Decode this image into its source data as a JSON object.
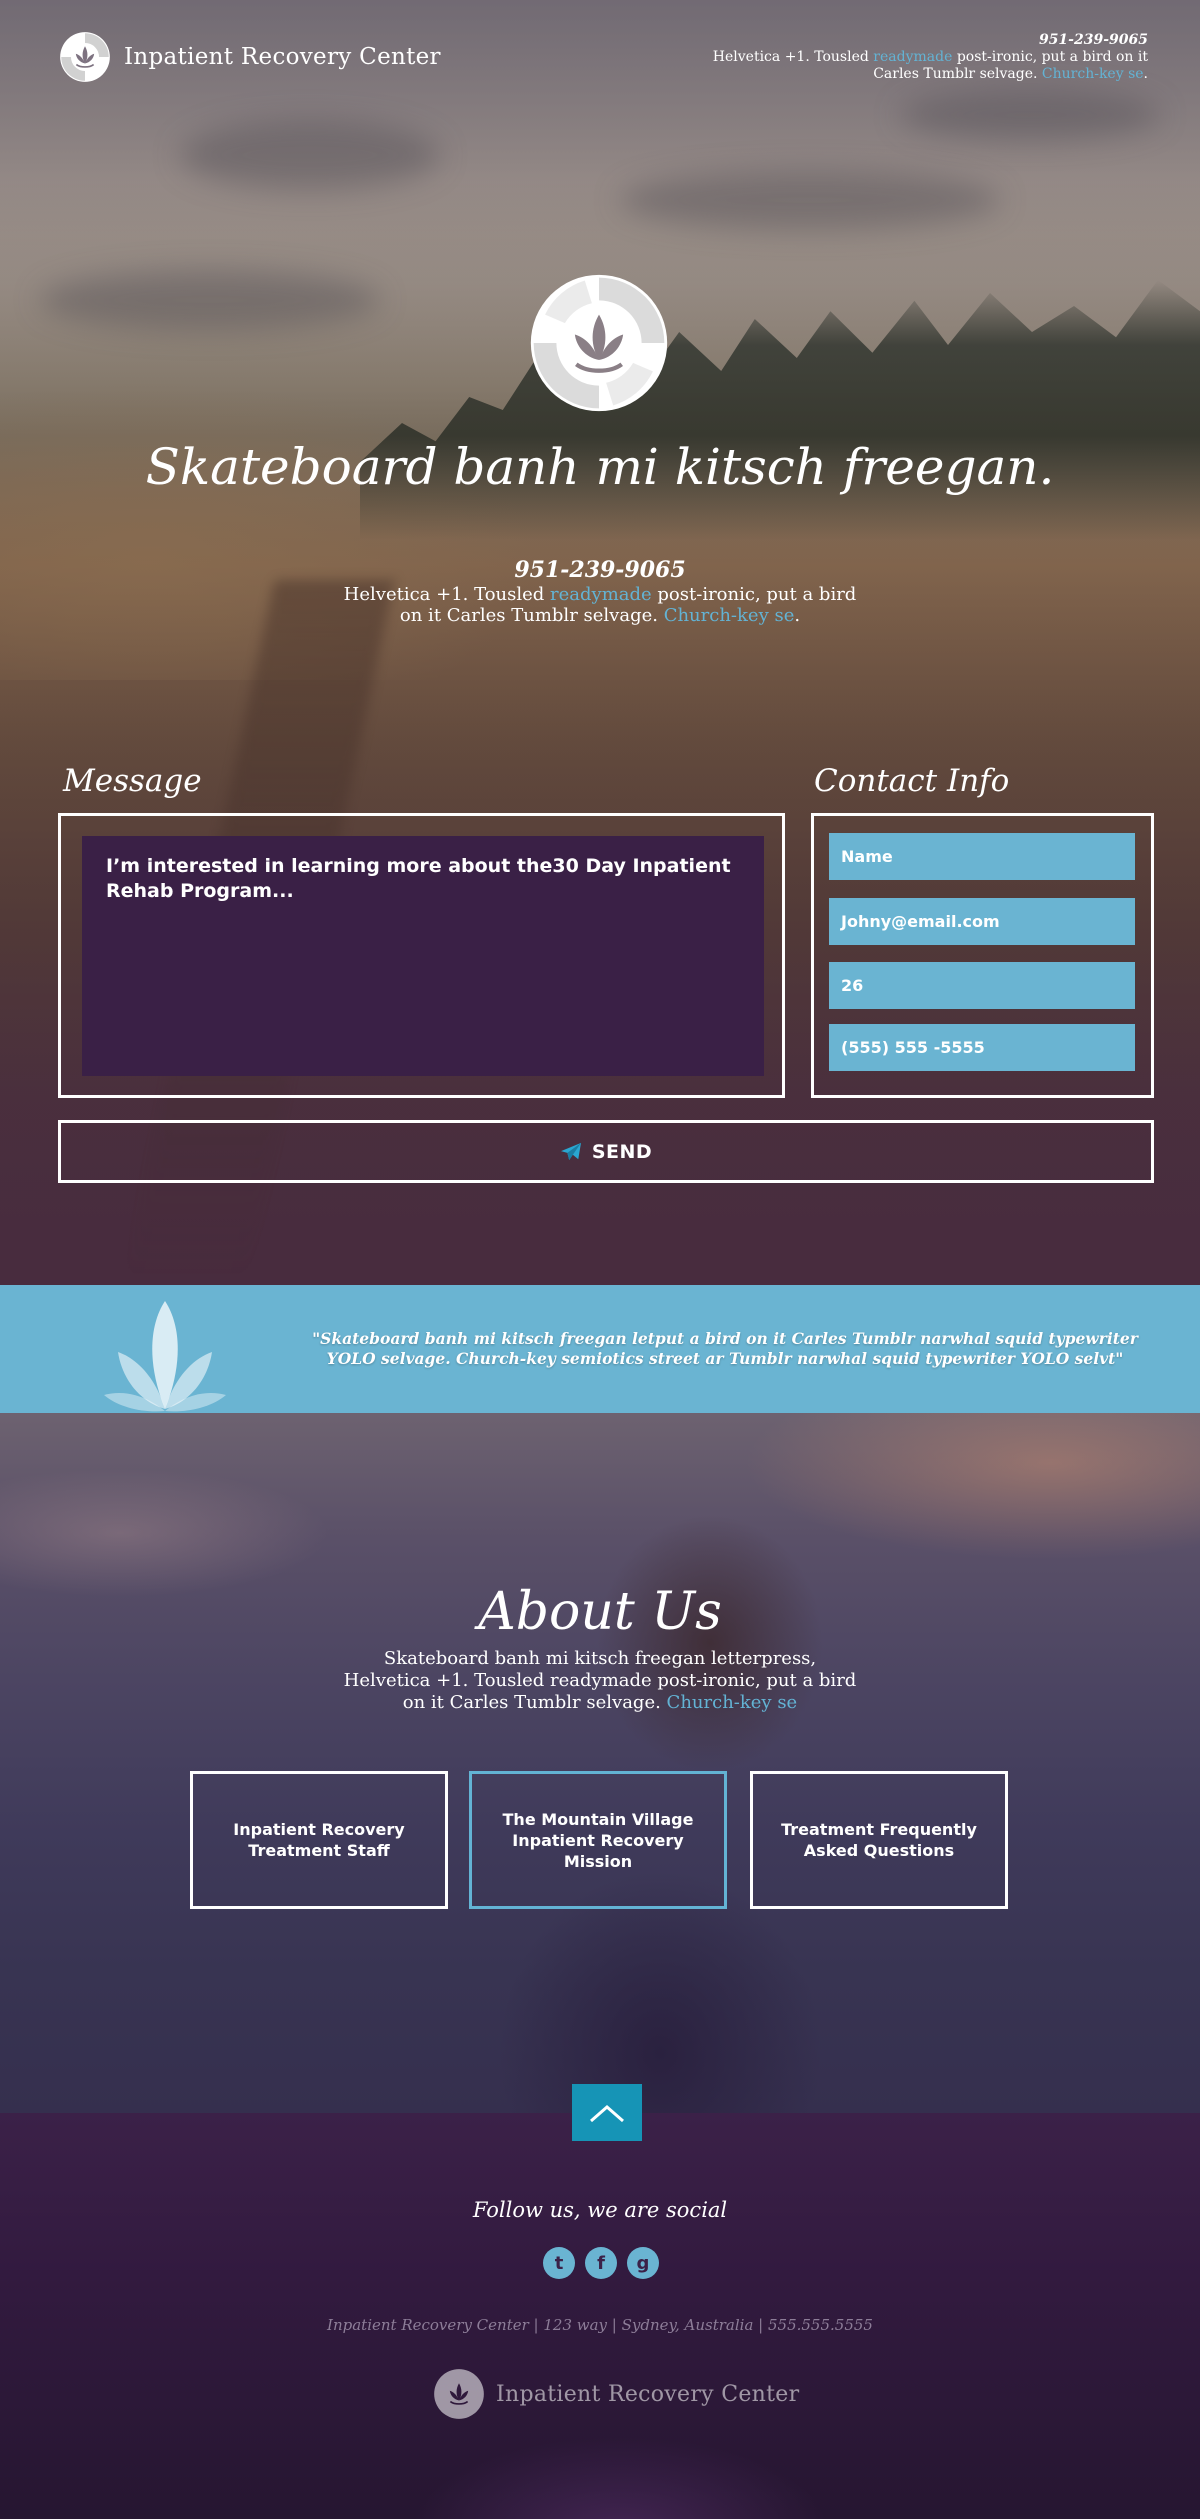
{
  "brand": {
    "name": "Inpatient Recovery Center"
  },
  "header": {
    "phone": "951-239-9065",
    "desc_part1": "Helvetica +1. Tousled ",
    "desc_link1": "readymade",
    "desc_part2": " post-ironic, put a bird on it Carles Tumblr selvage. ",
    "desc_link2": "Church-key se",
    "desc_end": "."
  },
  "hero": {
    "title": "Skateboard banh mi kitsch freegan.",
    "phone": "951-239-9065",
    "desc_part1": "Helvetica +1. Tousled ",
    "desc_link1": "readymade",
    "desc_part2": " post-ironic, put a bird on it Carles Tumblr selvage. ",
    "desc_link2": "Church-key se",
    "desc_end": "."
  },
  "form": {
    "message_heading": "Message",
    "contact_heading": "Contact Info",
    "message_text": "I’m interested in learning more about the30 Day Inpatient Rehab Program...",
    "fields": {
      "name": "Name",
      "email": "Johny@email.com",
      "age": "26",
      "phone": "(555) 555 -5555"
    },
    "send_label": "SEND"
  },
  "quote": {
    "text": "\"Skateboard banh mi kitsch freegan letput a bird on it Carles Tumblr narwhal squid typewriter YOLO selvage. Church-key semiotics street ar Tumblr narwhal squid typewriter YOLO selvt\""
  },
  "about": {
    "title": "About Us",
    "desc_part1": "Skateboard banh mi kitsch freegan letterpress, Helvetica +1. Tousled readymade post-ironic, put a bird on it Carles Tumblr selvage. ",
    "desc_link": "Church-key se",
    "cards": [
      {
        "label": "Inpatient Recovery Treatment Staff"
      },
      {
        "label": "The Mountain Village Inpatient Recovery Mission"
      },
      {
        "label": "Treatment Frequently Asked Questions"
      }
    ]
  },
  "footer": {
    "follow": "Follow us, we are social",
    "socials": [
      {
        "icon": "twitter-icon",
        "glyph": "t"
      },
      {
        "icon": "facebook-icon",
        "glyph": "f"
      },
      {
        "icon": "google-plus-icon",
        "glyph": "g"
      }
    ],
    "address": "Inpatient Recovery Center | 123 way | Sydney, Australia | 555.555.5555",
    "brand_name": "Inpatient Recovery Center"
  },
  "colors": {
    "accent": "#6ab4d2",
    "link": "#63b3d4",
    "message_bg": "#3a2046",
    "to_top": "#1694b6",
    "footer_bg": "#321a3f"
  }
}
